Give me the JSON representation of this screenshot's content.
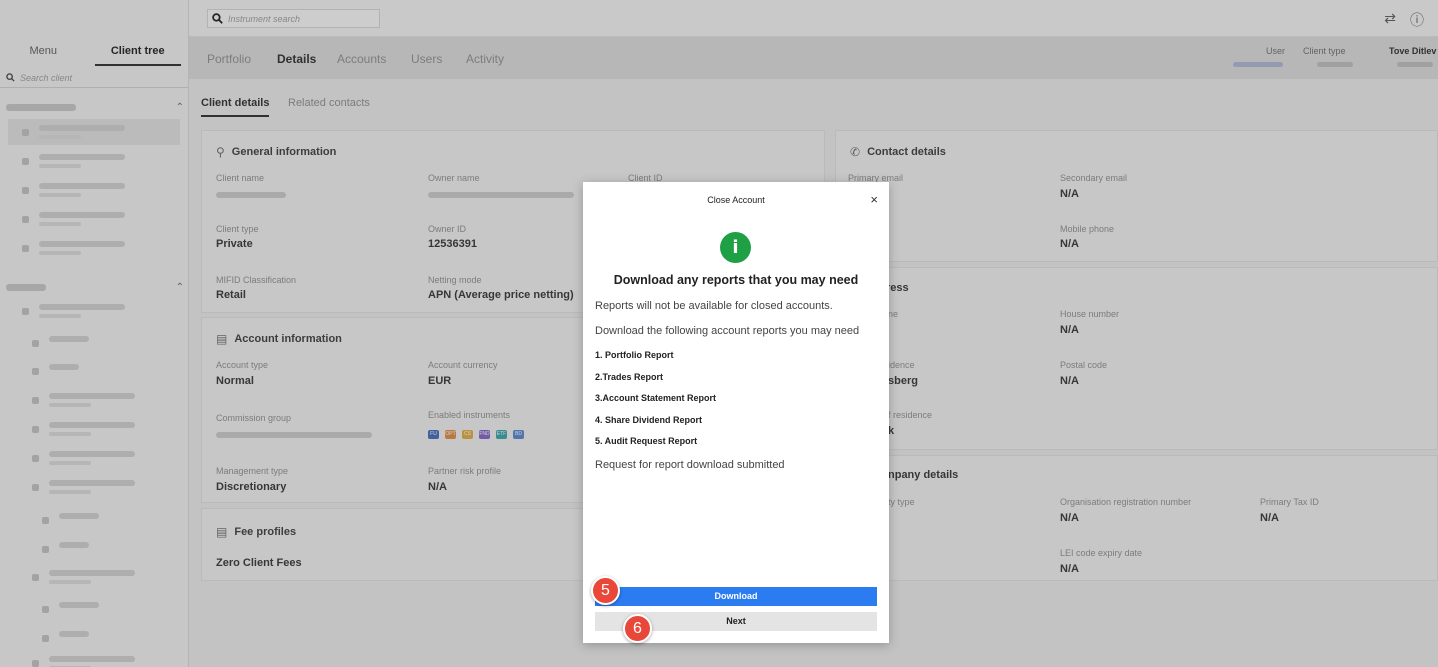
{
  "topbar": {
    "search_placeholder": "Instrument search",
    "icons": [
      "search-icon",
      "sliders-icon",
      "help-icon"
    ]
  },
  "sidebar": {
    "tabs": [
      "Menu",
      "Client tree"
    ],
    "active_tab": "Client tree",
    "search_placeholder": "Search client"
  },
  "nav": {
    "tabs": [
      "Portfolio",
      "Details",
      "Accounts",
      "Users",
      "Activity"
    ],
    "active_tab": "Details",
    "meta": {
      "user_label": "User",
      "client_type_label": "Client type",
      "name": "Tove Ditlev"
    }
  },
  "subtabs": [
    "Client details",
    "Related contacts"
  ],
  "general": {
    "title": "General information",
    "client_name_label": "Client name",
    "owner_name_label": "Owner name",
    "client_id_label": "Client ID",
    "client_type_label": "Client type",
    "client_type": "Private",
    "owner_id_label": "Owner ID",
    "owner_id": "12536391",
    "mifid_label": "MIFID Classification",
    "mifid": "Retail",
    "netting_label": "Netting mode",
    "netting": "APN (Average price netting)"
  },
  "account": {
    "title": "Account information",
    "type_label": "Account type",
    "type": "Normal",
    "currency_label": "Account currency",
    "currency": "EUR",
    "commission_label": "Commission group",
    "enabled_label": "Enabled instruments",
    "chips": [
      {
        "text": "FU",
        "color": "#3a63b8"
      },
      {
        "text": "OPT",
        "color": "#e0843a"
      },
      {
        "text": "CS",
        "color": "#e0a93a"
      },
      {
        "text": "FND",
        "color": "#7b5bc4"
      },
      {
        "text": "ETF",
        "color": "#2f9fa8"
      },
      {
        "text": "BD",
        "color": "#4f7fd0"
      }
    ],
    "mgmt_label": "Management type",
    "mgmt": "Discretionary",
    "risk_label": "Partner risk profile",
    "risk": "N/A"
  },
  "fees": {
    "title": "Fee profiles",
    "value": "Zero Client Fees"
  },
  "contact": {
    "title": "Contact details",
    "primary_email_label": "Primary email",
    "secondary_email_label": "Secondary email",
    "secondary_email": "N/A",
    "mobile_label": "Mobile phone",
    "mobile": "N/A"
  },
  "address": {
    "title_partial": "ress",
    "name_partial": "ne",
    "house_label": "House number",
    "house": "N/A",
    "residence_partial": "idence",
    "residence_value_partial": "sberg",
    "postal_label": "Postal code",
    "postal": "N/A",
    "country_partial": "f residence",
    "country_value_partial": "k"
  },
  "company": {
    "title_partial": "npany details",
    "entity_partial": "ty type",
    "org_label": "Organisation registration number",
    "org": "N/A",
    "tax_label": "Primary Tax ID",
    "tax": "N/A",
    "lei_label": "LEI code expiry date",
    "lei": "N/A"
  },
  "modal": {
    "title": "Close Account",
    "close": "×",
    "icon": "i",
    "heading": "Download any reports that you may need",
    "line1": "Reports will not be available for closed accounts.",
    "line2": "Download the following account reports you may need",
    "reports": [
      "1. Portfolio Report",
      "2.Trades Report",
      "3.Account Statement Report",
      "4. Share Dividend Report",
      "5. Audit Request Report"
    ],
    "status": "Request for report download submitted",
    "download_label": "Download",
    "next_label": "Next"
  },
  "markers": [
    "5",
    "6"
  ]
}
